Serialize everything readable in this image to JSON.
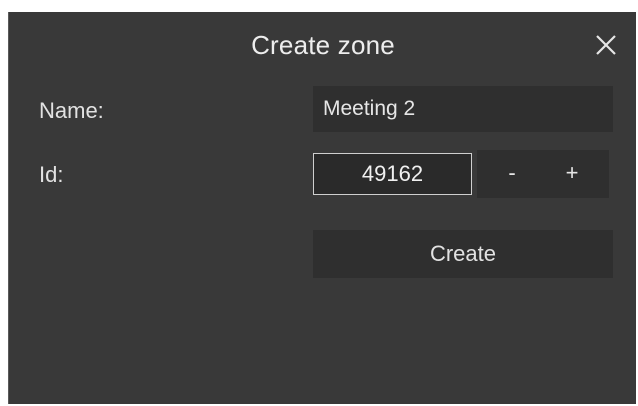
{
  "dialog": {
    "title": "Create zone",
    "close_icon": "close-icon"
  },
  "form": {
    "name_label": "Name:",
    "name_value": "Meeting 2",
    "id_label": "Id:",
    "id_value": "49162",
    "decrement_label": "-",
    "increment_label": "+",
    "create_label": "Create"
  },
  "colors": {
    "dialog_background": "#393939",
    "field_background": "#2f2f2f",
    "text": "#e6e6e6"
  }
}
